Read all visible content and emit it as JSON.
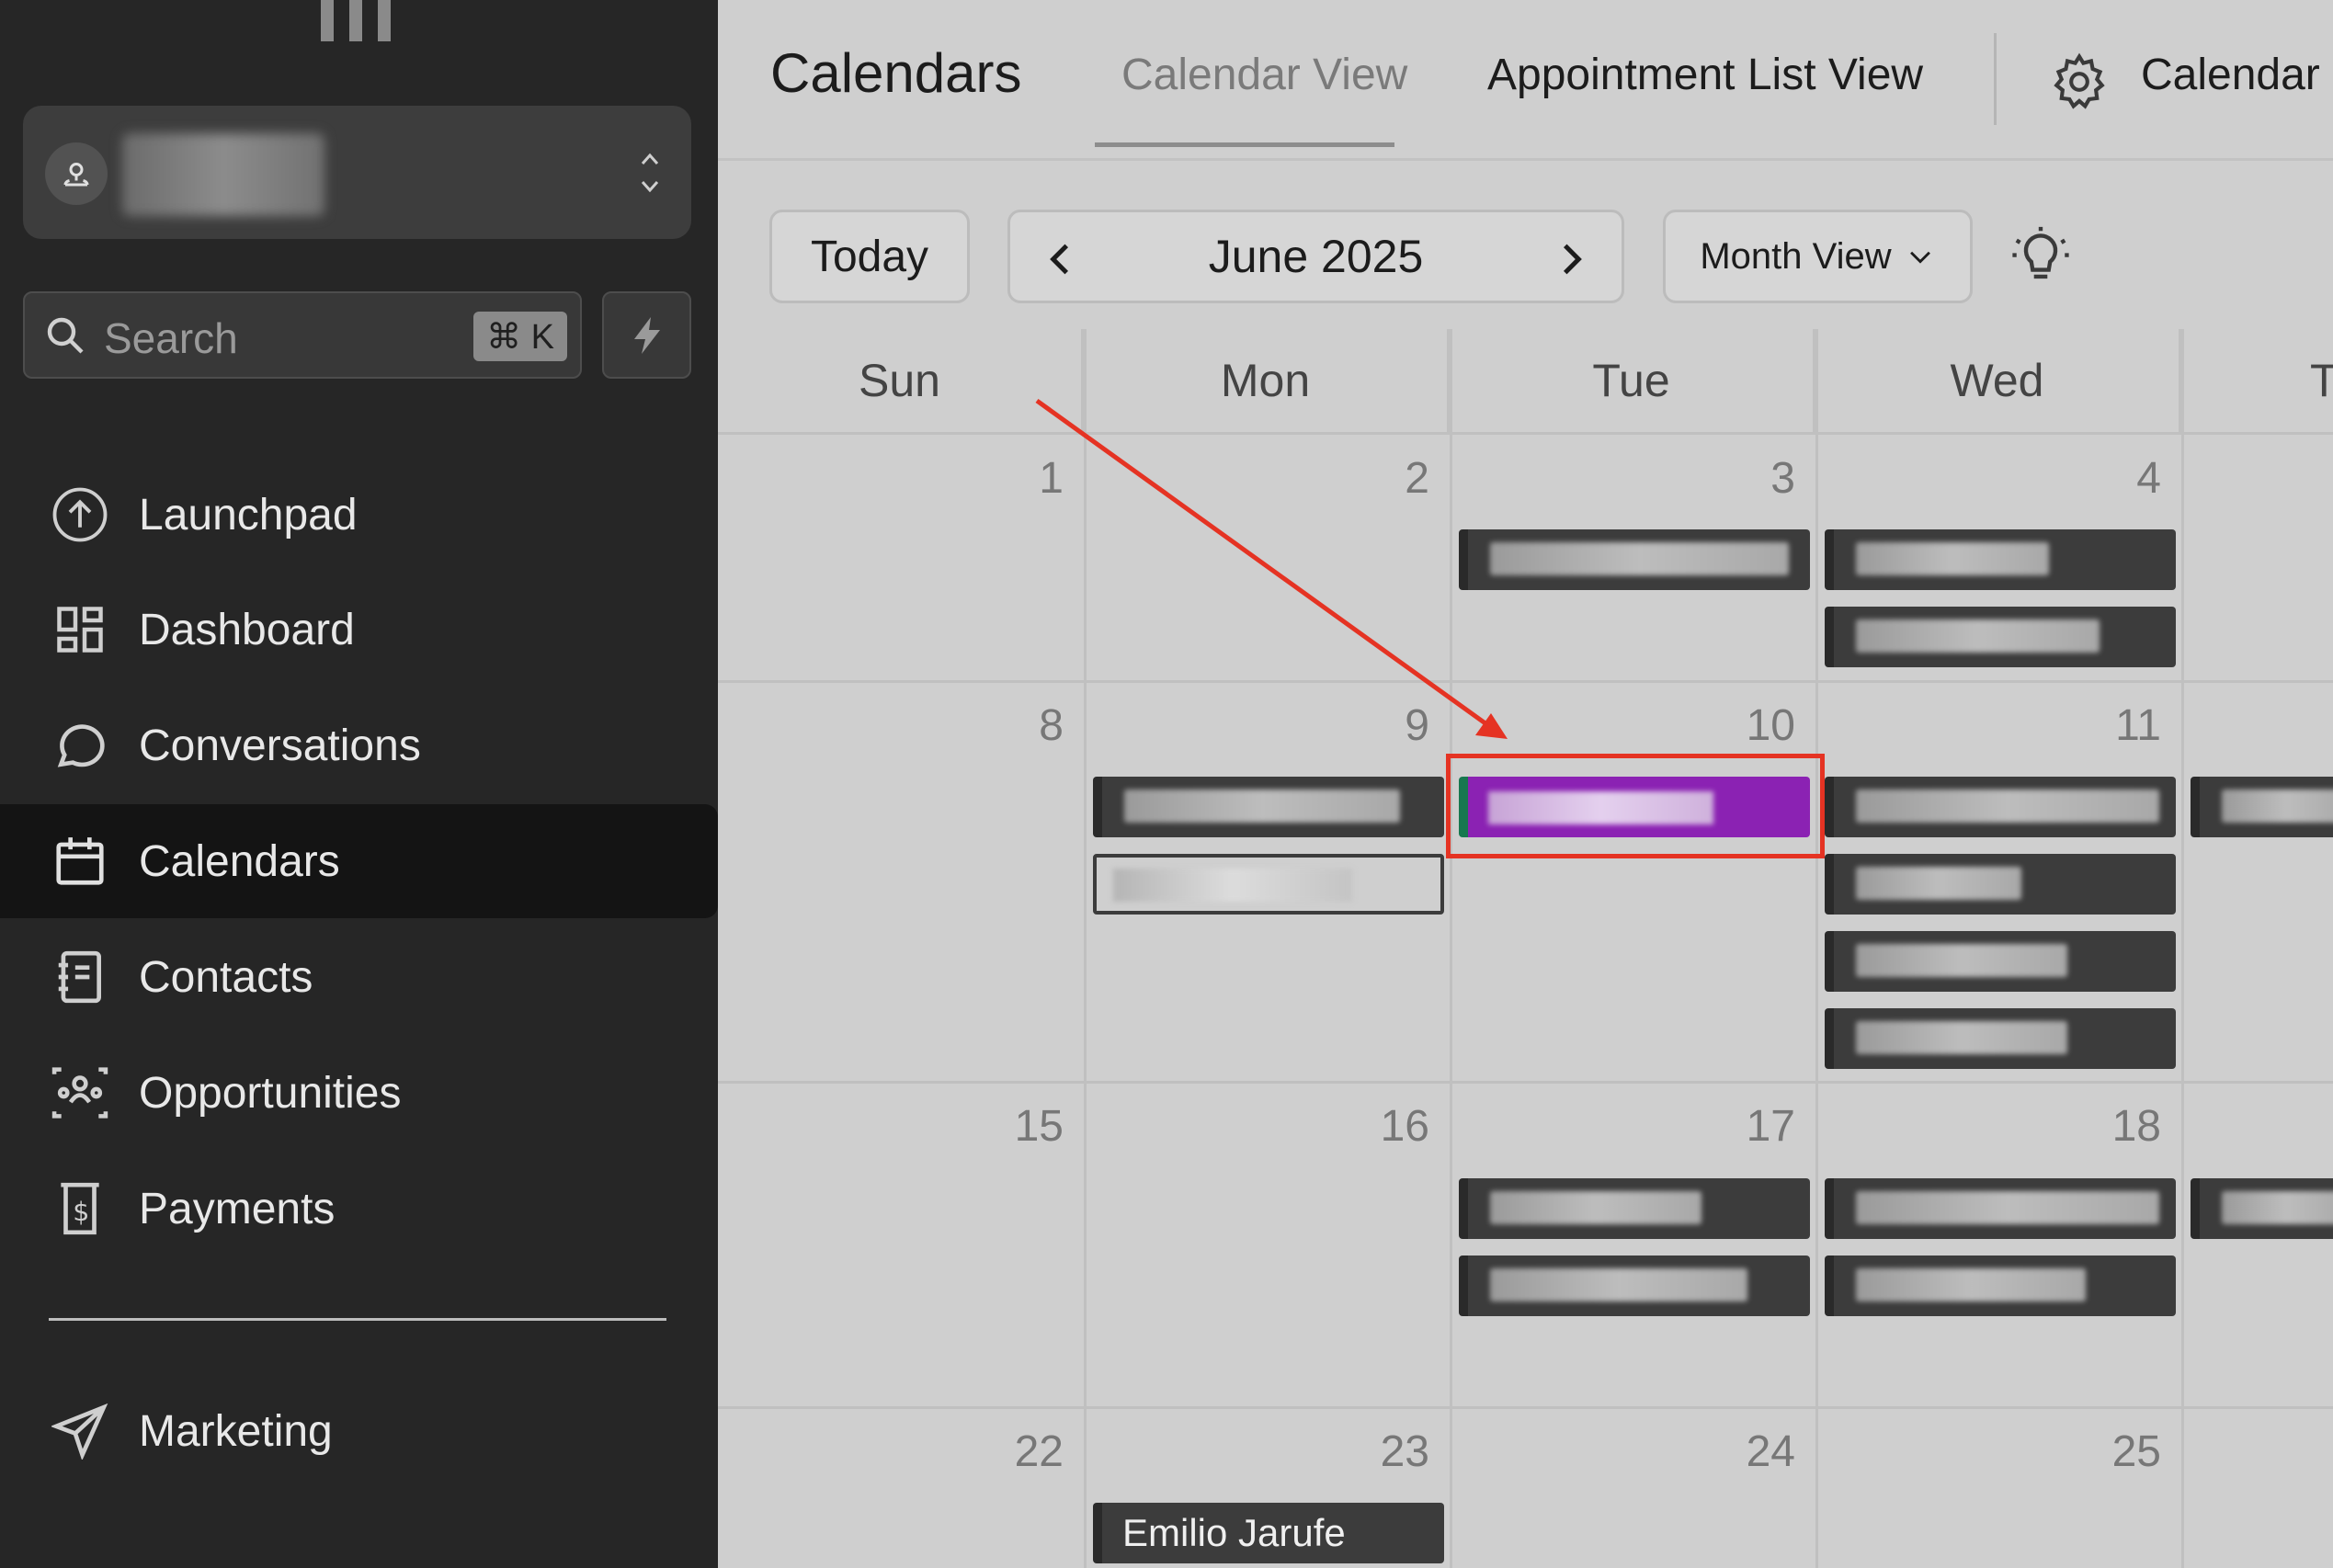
{
  "sidebar": {
    "search": {
      "placeholder": "Search",
      "shortcut": "⌘ K"
    },
    "nav": [
      {
        "label": "Launchpad",
        "icon": "launchpad-icon"
      },
      {
        "label": "Dashboard",
        "icon": "dashboard-icon"
      },
      {
        "label": "Conversations",
        "icon": "chat-icon"
      },
      {
        "label": "Calendars",
        "icon": "calendar-icon",
        "active": true
      },
      {
        "label": "Contacts",
        "icon": "contacts-icon"
      },
      {
        "label": "Opportunities",
        "icon": "opportunities-icon"
      },
      {
        "label": "Payments",
        "icon": "payments-icon"
      },
      {
        "label": "Marketing",
        "icon": "send-icon"
      }
    ]
  },
  "header": {
    "title": "Calendars",
    "tabs": {
      "calendar_view": "Calendar View",
      "list_view": "Appointment List View",
      "settings": "Calendar"
    }
  },
  "toolbar": {
    "today": "Today",
    "period": "June 2025",
    "view_mode": "Month View"
  },
  "calendar": {
    "weekdays": [
      "Sun",
      "Mon",
      "Tue",
      "Wed",
      "T"
    ],
    "weeks": [
      [
        "1",
        "2",
        "3",
        "4"
      ],
      [
        "8",
        "9",
        "10",
        "11"
      ],
      [
        "15",
        "16",
        "17",
        "18"
      ],
      [
        "22",
        "23",
        "24",
        "25"
      ]
    ],
    "named_event": "Emilio Jarufe"
  },
  "colors": {
    "highlighted_event": "#8b22b3",
    "annotation": "#e53323"
  }
}
